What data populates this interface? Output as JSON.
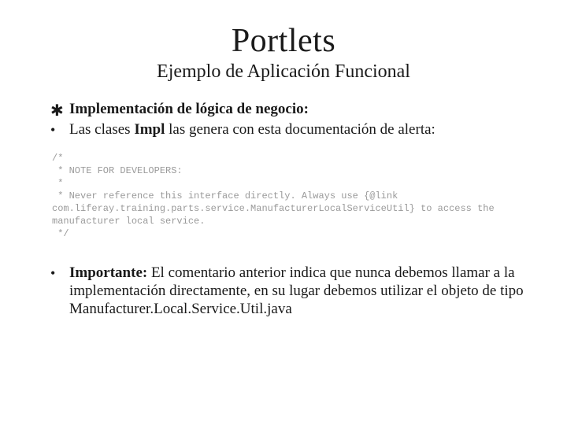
{
  "title": "Portlets",
  "subtitle": "Ejemplo de Aplicación Funcional",
  "bullets": {
    "b1_bold": "Implementación de lógica de negocio:",
    "b2_pre": "Las clases ",
    "b2_bold": "Impl",
    "b2_post": " las genera con esta documentación de alerta:",
    "b3_label": "Importante:",
    "b3_rest": " El comentario anterior indica que nunca debemos llamar a la implementación directamente, en su lugar debemos utilizar el objeto de tipo Manufacturer.Local.Service.Util.java"
  },
  "code": "/*\n * NOTE FOR DEVELOPERS:\n *\n * Never reference this interface directly. Always use {@link\ncom.liferay.training.parts.service.ManufacturerLocalServiceUtil} to access the\nmanufacturer local service.\n */"
}
